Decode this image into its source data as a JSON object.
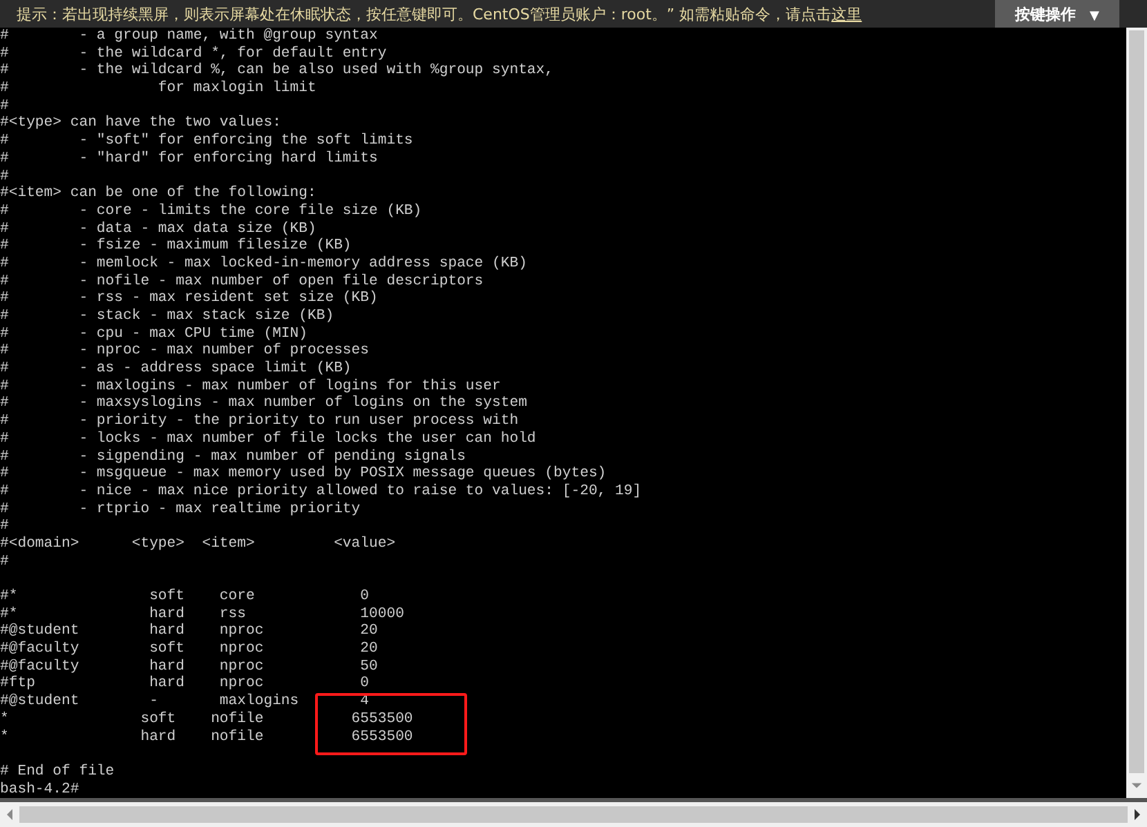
{
  "notice_bar": {
    "text": "提示：若出现持续黑屏，则表示屏幕处在休眠状态，按任意键即可。CentOS管理员账户：root。” 如需粘贴命令，请点击",
    "link": "这里"
  },
  "key_menu": {
    "label": "按键操作",
    "caret": "▼"
  },
  "terminal": {
    "lines": [
      "#        - a group name, with @group syntax",
      "#        - the wildcard *, for default entry",
      "#        - the wildcard %, can be also used with %group syntax,",
      "#                 for maxlogin limit",
      "#",
      "#<type> can have the two values:",
      "#        - \"soft\" for enforcing the soft limits",
      "#        - \"hard\" for enforcing hard limits",
      "#",
      "#<item> can be one of the following:",
      "#        - core - limits the core file size (KB)",
      "#        - data - max data size (KB)",
      "#        - fsize - maximum filesize (KB)",
      "#        - memlock - max locked-in-memory address space (KB)",
      "#        - nofile - max number of open file descriptors",
      "#        - rss - max resident set size (KB)",
      "#        - stack - max stack size (KB)",
      "#        - cpu - max CPU time (MIN)",
      "#        - nproc - max number of processes",
      "#        - as - address space limit (KB)",
      "#        - maxlogins - max number of logins for this user",
      "#        - maxsyslogins - max number of logins on the system",
      "#        - priority - the priority to run user process with",
      "#        - locks - max number of file locks the user can hold",
      "#        - sigpending - max number of pending signals",
      "#        - msgqueue - max memory used by POSIX message queues (bytes)",
      "#        - nice - max nice priority allowed to raise to values: [-20, 19]",
      "#        - rtprio - max realtime priority",
      "#",
      "#<domain>      <type>  <item>         <value>",
      "#",
      {
        "kind": "blank"
      },
      "#*               soft    core            0",
      "#*               hard    rss             10000",
      "#@student        hard    nproc           20",
      "#@faculty        soft    nproc           20",
      "#@faculty        hard    nproc           50",
      "#ftp             hard    nproc           0",
      "#@student        -       maxlogins       4",
      "*               soft    nofile          6553500",
      "*               hard    nofile          6553500",
      {
        "kind": "blank"
      },
      "# End of file",
      "bash-4.2#"
    ]
  }
}
